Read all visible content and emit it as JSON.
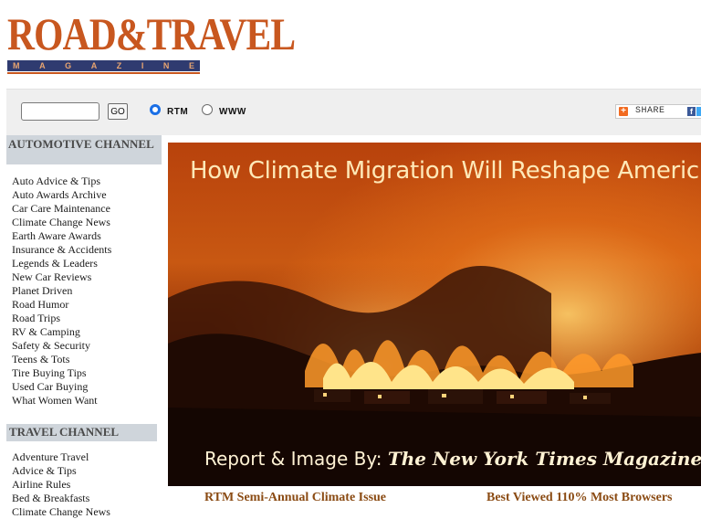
{
  "logo": {
    "main": "ROAD&TRAVEL",
    "sub": [
      "M",
      "A",
      "G",
      "A",
      "Z",
      "I",
      "N",
      "E"
    ]
  },
  "toolbar": {
    "search_value": "",
    "go_label": "GO",
    "radio_rtm_label": "RTM",
    "radio_www_label": "WWW",
    "selected": "RTM",
    "share_label": "SHARE"
  },
  "sidebar": {
    "automotive_heading": "AUTOMOTIVE CHANNEL",
    "automotive_items": [
      "Auto Advice & Tips",
      "Auto Awards Archive",
      "Car Care Maintenance",
      "Climate Change News",
      "Earth Aware Awards",
      "Insurance & Accidents",
      "Legends & Leaders",
      "New Car Reviews",
      "Planet Driven",
      "Road Humor",
      "Road Trips",
      "RV & Camping",
      "Safety & Security",
      "Teens & Tots",
      "Tire Buying Tips",
      "Used Car Buying",
      "What Women Want"
    ],
    "travel_heading": "TRAVEL CHANNEL",
    "travel_items": [
      "Adventure Travel",
      "Advice & Tips",
      "Airline Rules",
      "Bed & Breakfasts",
      "Climate Change News"
    ]
  },
  "hero": {
    "title": "How Climate Migration Will Reshape Americ",
    "credit_prefix": "Report & Image By: ",
    "credit_source": "The New York Times Magazine"
  },
  "captions": {
    "left": "RTM Semi-Annual Climate Issue",
    "right": "Best Viewed 110% Most Browsers"
  },
  "colors": {
    "logo_orange": "#c8571f",
    "logo_navy": "#2f3b70",
    "caption_brown": "#8a4a12",
    "sidebar_header_bg": "#cfd5db",
    "toolbar_bg": "#efefef"
  }
}
